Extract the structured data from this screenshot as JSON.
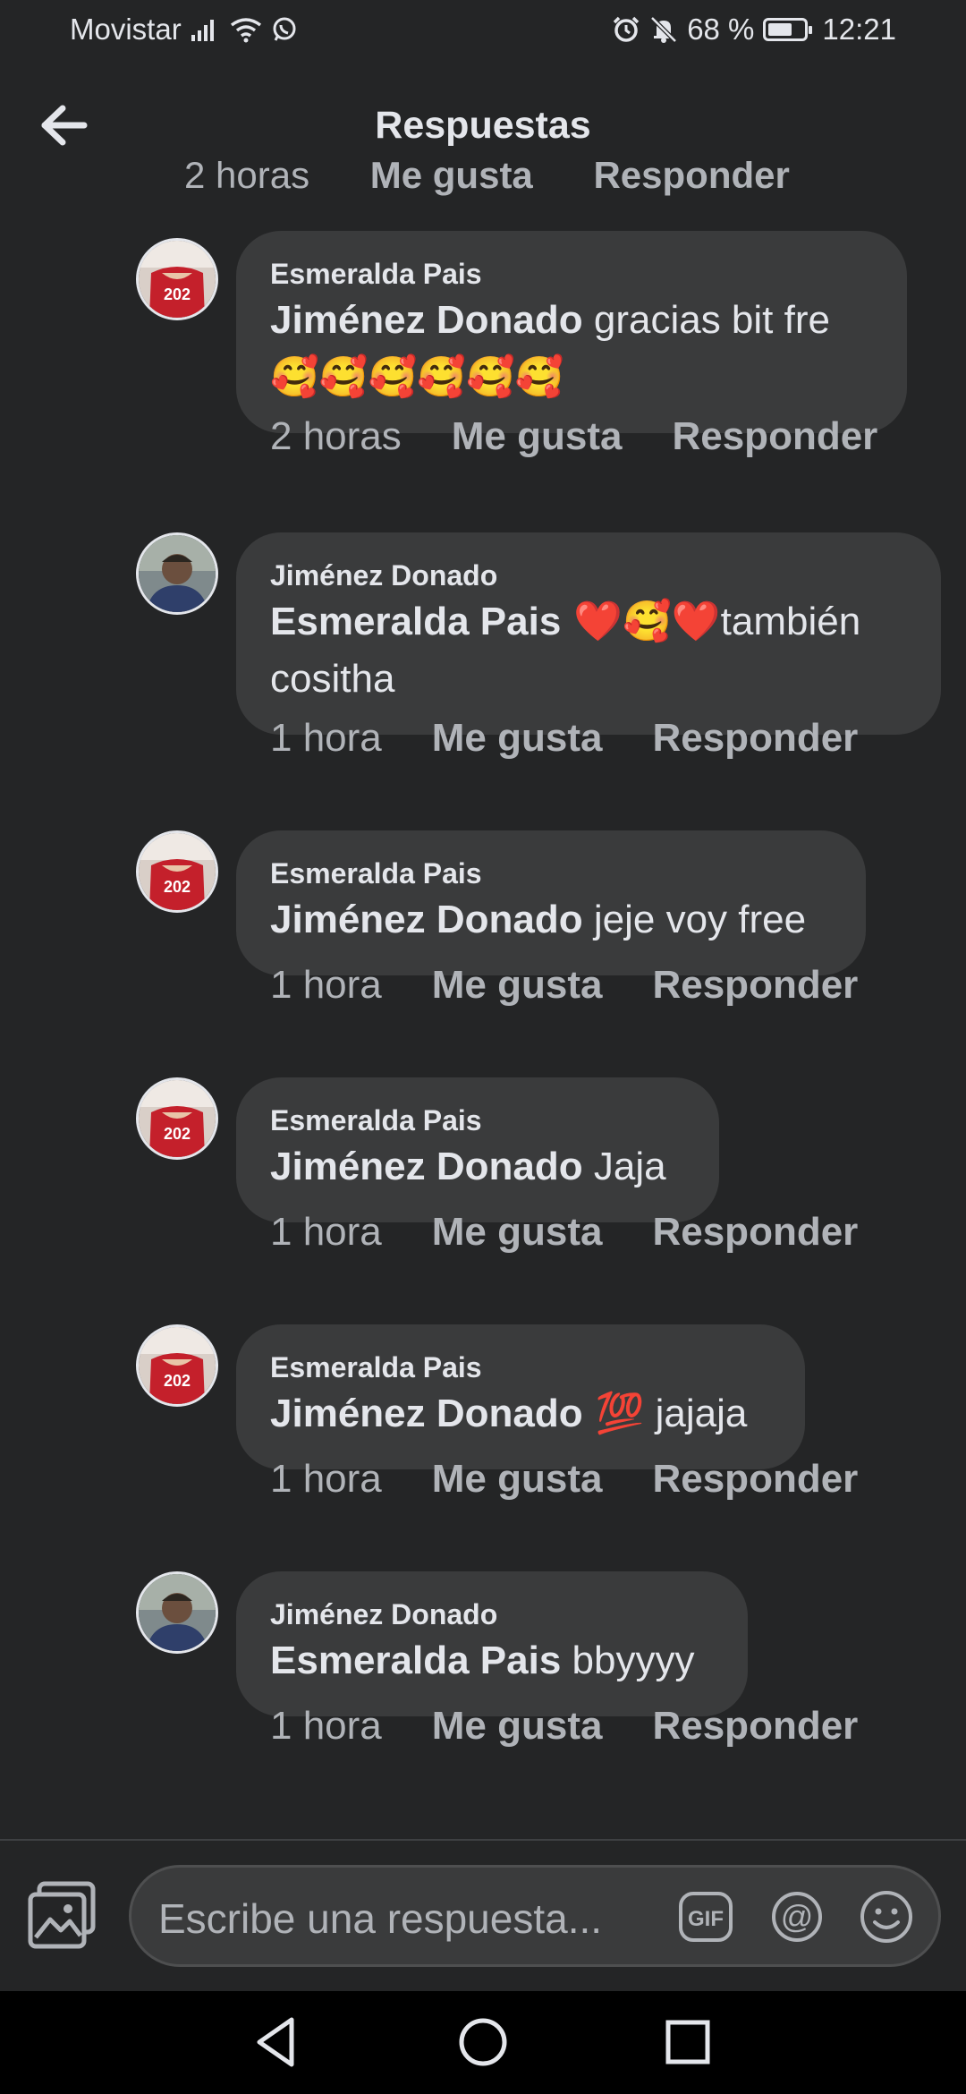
{
  "status_bar": {
    "carrier": "Movistar",
    "battery_percent": "68 %",
    "battery_level": 0.68,
    "time": "12:21"
  },
  "header": {
    "title": "Respuestas"
  },
  "cut_off_actions": {
    "time": "2 horas",
    "like": "Me gusta",
    "reply": "Responder"
  },
  "comments": [
    {
      "author": "Esmeralda Pais",
      "mention": "Jiménez Donado",
      "text": " gracias bit fre",
      "emoji": "🥰🥰🥰🥰🥰🥰",
      "time": "2 horas",
      "like": "Me gusta",
      "reply": "Responder",
      "avatar": "red"
    },
    {
      "author": "Jiménez Donado",
      "mention": "Esmeralda Pais",
      "text": "también cositha",
      "emoji": " ❤️🥰❤️",
      "time": "1 hora",
      "like": "Me gusta",
      "reply": "Responder",
      "avatar": "blue"
    },
    {
      "author": "Esmeralda Pais",
      "mention": "Jiménez Donado",
      "text": " jeje voy free",
      "time": "1 hora",
      "like": "Me gusta",
      "reply": "Responder",
      "avatar": "red"
    },
    {
      "author": "Esmeralda Pais",
      "mention": "Jiménez Donado",
      "text": " Jaja",
      "time": "1 hora",
      "like": "Me gusta",
      "reply": "Responder",
      "avatar": "red"
    },
    {
      "author": "Esmeralda Pais",
      "mention": "Jiménez Donado",
      "text": " jajaja",
      "emoji": " 💯",
      "time": "1 hora",
      "like": "Me gusta",
      "reply": "Responder",
      "avatar": "red"
    },
    {
      "author": "Jiménez Donado",
      "mention": "Esmeralda Pais",
      "text": " bbyyyy",
      "time": "1 hora",
      "like": "Me gusta",
      "reply": "Responder",
      "avatar": "blue"
    }
  ],
  "composer": {
    "placeholder": "Escribe una respuesta...",
    "gif_label": "GIF"
  }
}
